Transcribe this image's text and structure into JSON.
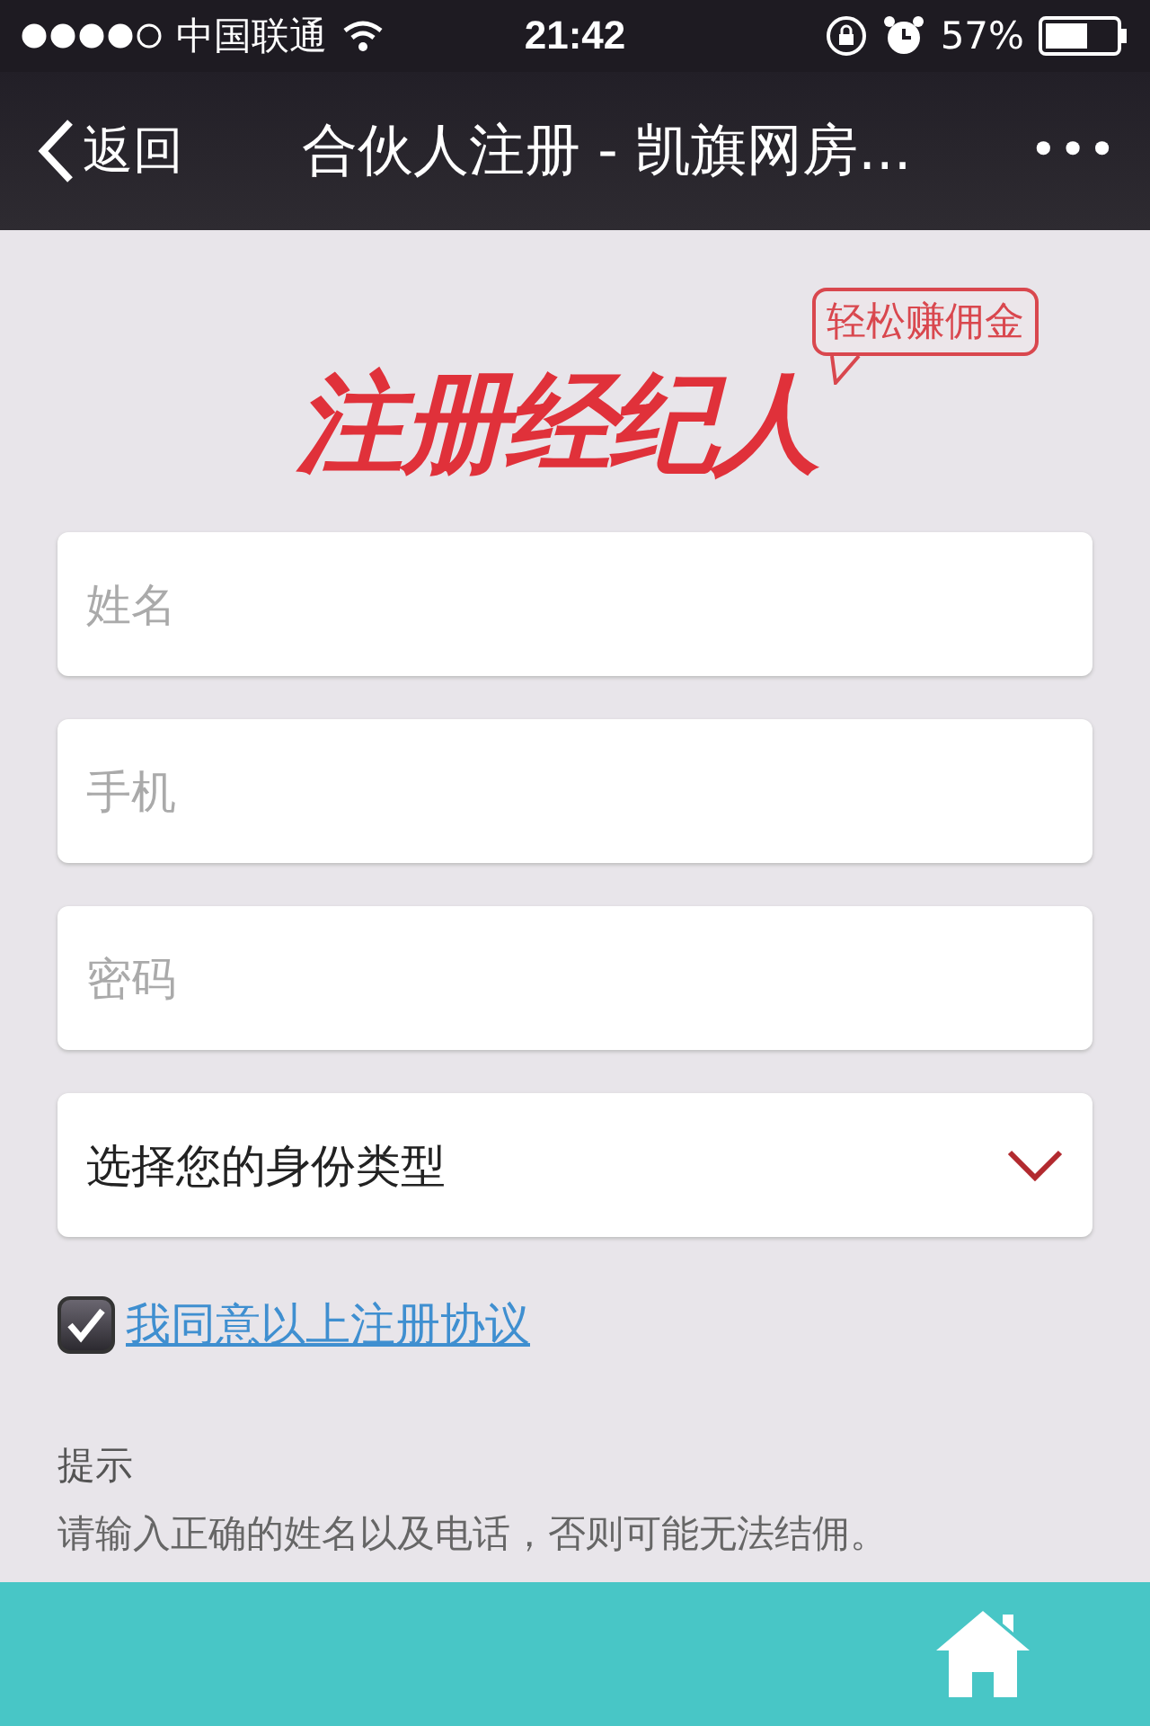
{
  "status_bar": {
    "carrier": "中国联通",
    "time": "21:42",
    "battery": "57%"
  },
  "nav_bar": {
    "back": "返回",
    "title": "合伙人注册 - 凯旗网房...",
    "more": "•••"
  },
  "banner": {
    "title": "注册经纪人",
    "bubble": "轻松赚佣金"
  },
  "fields": [
    {
      "kind": "input",
      "placeholder": "姓名"
    },
    {
      "kind": "input",
      "placeholder": "手机"
    },
    {
      "kind": "input",
      "placeholder": "密码"
    },
    {
      "kind": "select",
      "value": "选择您的身份类型"
    }
  ],
  "agreement": {
    "checked": true,
    "link": "我同意以上注册协议"
  },
  "hint": {
    "title": "提示",
    "text": "请输入正确的姓名以及电话，否则可能无法结佣。"
  }
}
